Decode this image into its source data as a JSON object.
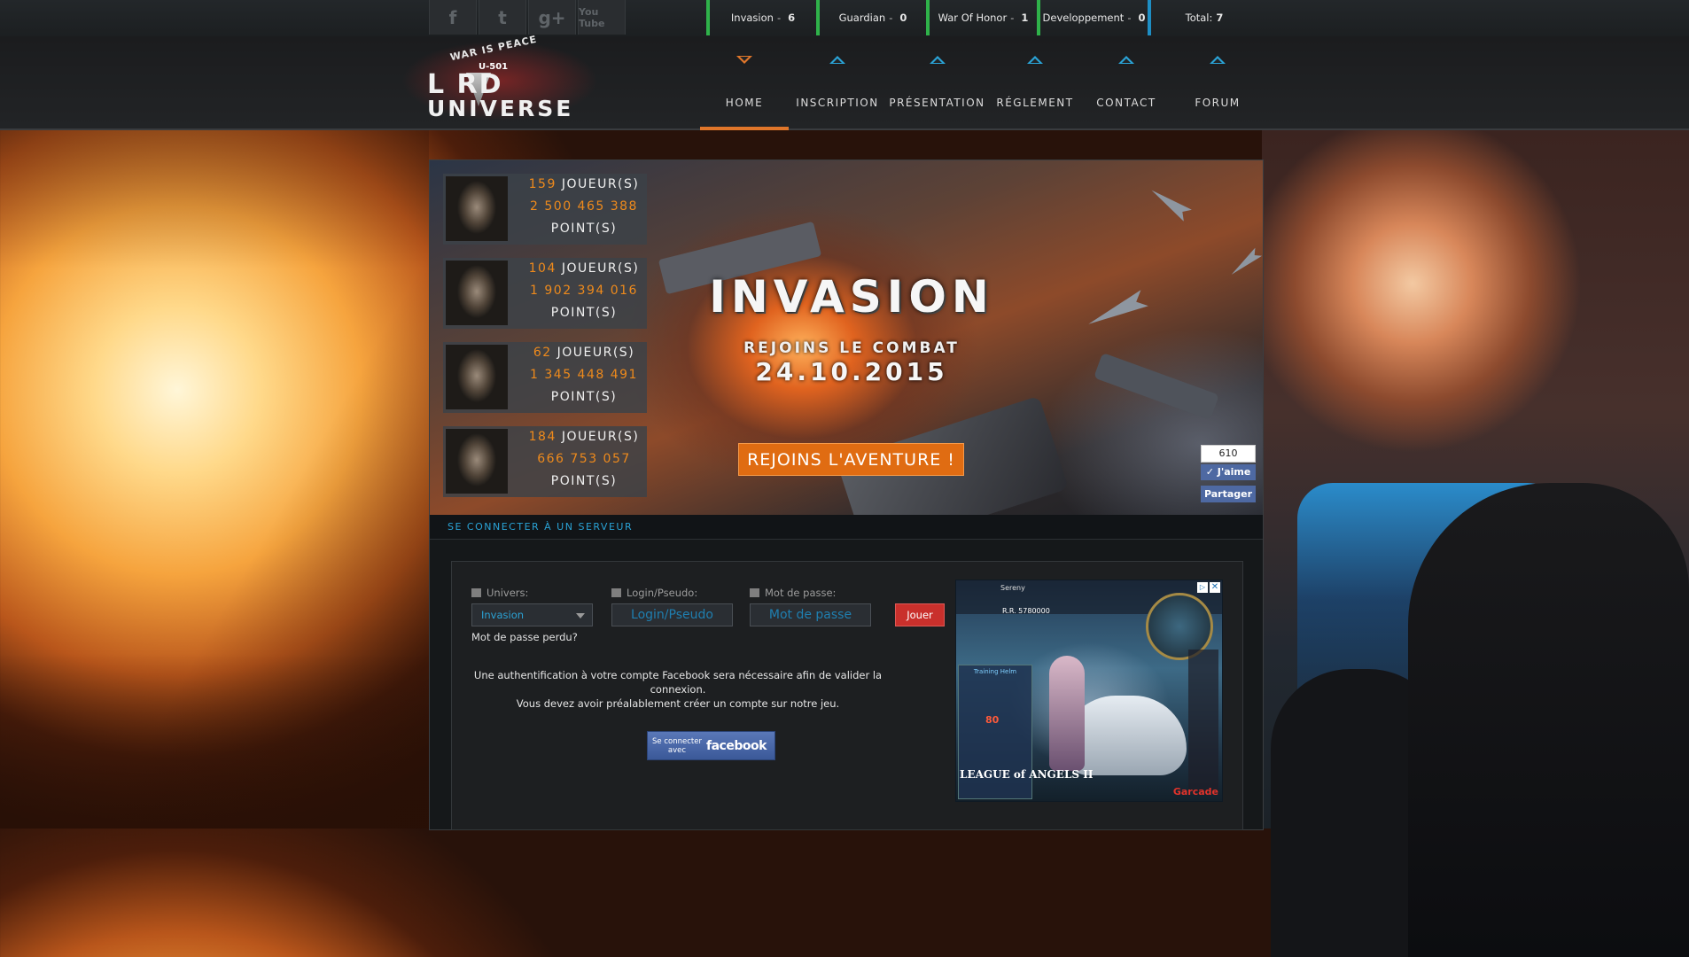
{
  "social": [
    {
      "icon": "facebook-icon",
      "glyph": "f"
    },
    {
      "icon": "twitter-icon",
      "glyph": "t"
    },
    {
      "icon": "google-plus-icon",
      "glyph": "g+"
    },
    {
      "icon": "youtube-icon",
      "glyph": "You Tube"
    }
  ],
  "stats": [
    {
      "label": "Invasion",
      "value": "6"
    },
    {
      "label": "Guardian",
      "value": "0"
    },
    {
      "label": "War Of Honor",
      "value": "1"
    },
    {
      "label": "Developpement",
      "value": "0"
    }
  ],
  "total": {
    "label": "Total:",
    "value": "7"
  },
  "logo": {
    "tagline": "WAR IS PEACE",
    "code": "U-501",
    "word1": "L RD",
    "word2": "UNIVERSE"
  },
  "nav": [
    "HOME",
    "INSCRIPTION",
    "PRÉSENTATION",
    "RÉGLEMENT",
    "CONTACT",
    "FORUM"
  ],
  "servers": [
    {
      "players": "159",
      "players_label": "JOUEUR(S)",
      "points": "2 500 465 388",
      "points_label": "POINT(S)"
    },
    {
      "players": "104",
      "players_label": "JOUEUR(S)",
      "points": "1 902 394 016",
      "points_label": "POINT(S)"
    },
    {
      "players": "62",
      "players_label": "JOUEUR(S)",
      "points": "1 345 448 491",
      "points_label": "POINT(S)"
    },
    {
      "players": "184",
      "players_label": "JOUEUR(S)",
      "points": "666 753 057",
      "points_label": "POINT(S)"
    }
  ],
  "banner": {
    "title": "INVASION",
    "subtitle": "REJOINS LE COMBAT",
    "date": "24.10.2015",
    "cta": "REJOINS L'AVENTURE !"
  },
  "fb_like": {
    "count": "610",
    "like": "J'aime",
    "share": "Partager"
  },
  "section_title": "SE CONNECTER À UN SERVEUR",
  "login": {
    "univers_label": "Univers:",
    "univers_value": "Invasion",
    "login_label": "Login/Pseudo:",
    "login_placeholder": "Login/Pseudo",
    "password_label": "Mot de passe:",
    "password_placeholder": "Mot de passe",
    "submit": "Jouer",
    "lost_password": "Mot de passe perdu?",
    "auth_note_1": "Une authentification à votre compte Facebook sera nécessaire afin de valider la connexion.",
    "auth_note_2": "Vous devez avoir préalablement créer un compte sur notre jeu.",
    "fb_connect_small": "Se connecter avec",
    "fb_connect_brand": "facebook"
  },
  "ad": {
    "hud_name": "Sereny",
    "hud_value": "R.R. 5780000",
    "panel_title": "Training Helm",
    "panel_number": "80",
    "game": "LEAGUE of ANGELS II",
    "brand_g": "G",
    "brand_rest": "arcade",
    "close": "✕",
    "adchoices": "▷"
  }
}
